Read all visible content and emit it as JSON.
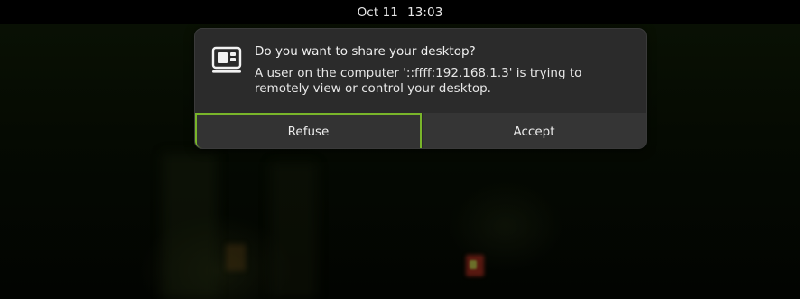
{
  "topbar": {
    "date": "Oct 11",
    "time": "13:03"
  },
  "dialog": {
    "icon": "remote-desktop-icon",
    "title": "Do you want to share your desktop?",
    "message": "A user on the computer '::ffff:192.168.1.3' is trying to remotely view or control your desktop.",
    "buttons": {
      "refuse": "Refuse",
      "accept": "Accept"
    },
    "focus_color": "#79b52a"
  }
}
